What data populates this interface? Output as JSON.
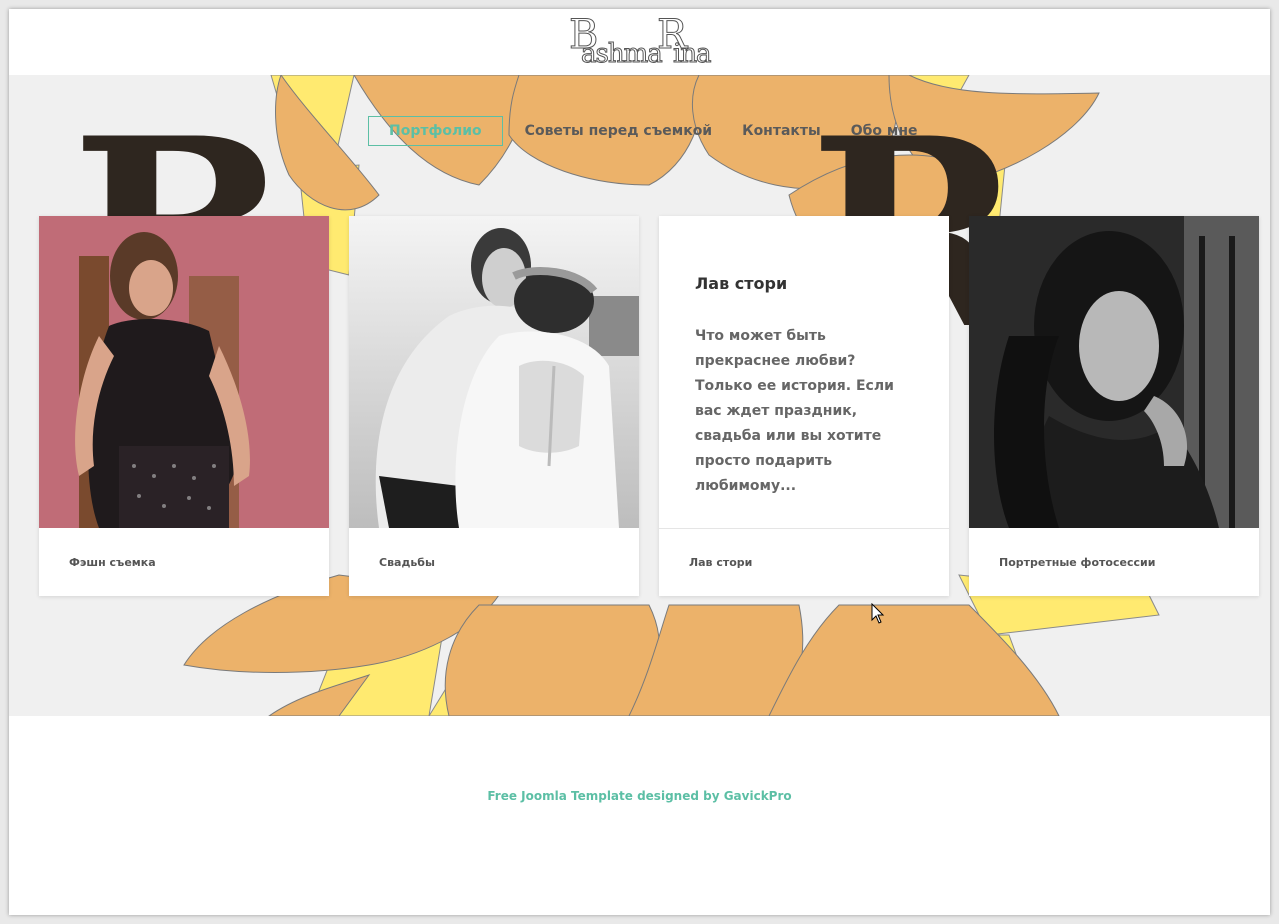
{
  "header": {
    "logo": {
      "cap1": "B",
      "rest1": "ashma",
      "cap2": "R",
      "rest2": "ina"
    }
  },
  "nav": {
    "items": [
      {
        "label": "Портфолио",
        "active": true
      },
      {
        "label": "Советы перед съемкой",
        "active": false
      },
      {
        "label": "Контакты",
        "active": false
      },
      {
        "label": "Обо мне",
        "active": false
      }
    ]
  },
  "cards": [
    {
      "caption": "Фэшн съемка"
    },
    {
      "caption": "Свадьбы"
    },
    {
      "caption": "Лав стори",
      "title": "Лав стори",
      "description": "Что может быть прекраснее любви? Только ее история. Если вас ждет праздник, свадьба или вы хотите просто подарить любимому..."
    },
    {
      "caption": "Портретные фотосессии"
    }
  ],
  "footer": {
    "credit": "Free Joomla Template designed by GavickPro"
  },
  "colors": {
    "accent": "#5cbfa5",
    "petal_orange": "#ecb26a",
    "petal_yellow": "#ffea70",
    "letter_dark": "#2e261f",
    "hero_bg": "#f0f0f0"
  }
}
